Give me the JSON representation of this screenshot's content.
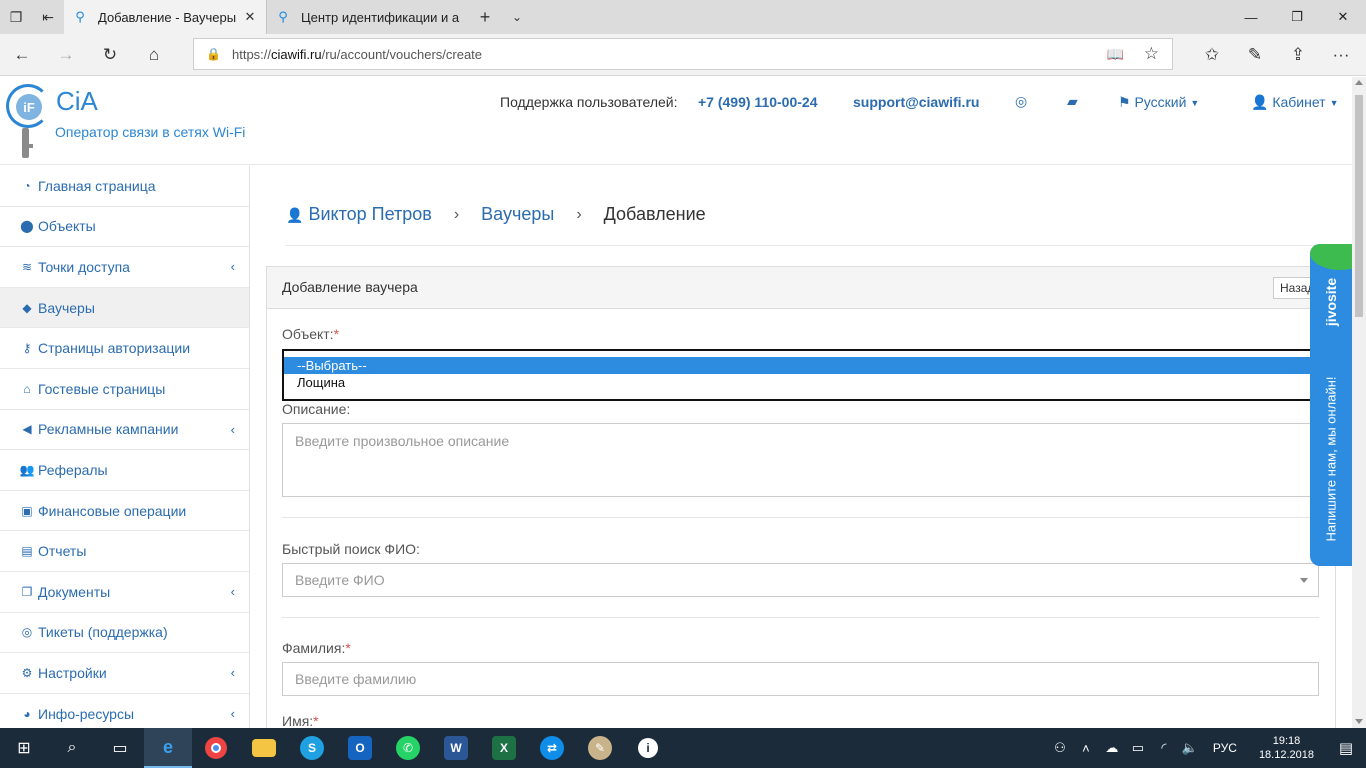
{
  "browser": {
    "tabs": [
      {
        "title": "Добавление - Ваучеры",
        "active": true
      },
      {
        "title": "Центр идентификации и а",
        "active": false
      }
    ],
    "url_prefix": "https://",
    "url_host": "ciawifi.ru",
    "url_path": "/ru/account/vouchers/create"
  },
  "header": {
    "brand": "CiA",
    "tagline": "Оператор связи в сетях Wi-Fi",
    "support_label": "Поддержка пользователей:",
    "phone": "+7 (499) 110-00-24",
    "email": "support@ciawifi.ru",
    "language": "Русский",
    "cabinet": "Кабинет"
  },
  "sidebar": {
    "items": [
      {
        "label": "Главная страница",
        "icon": "dashboard-icon",
        "glyph": "◔",
        "expandable": false,
        "active": false
      },
      {
        "label": "Объекты",
        "icon": "map-marker-icon",
        "glyph": "⬤",
        "expandable": false,
        "active": false
      },
      {
        "label": "Точки доступа",
        "icon": "wifi-icon",
        "glyph": "≋",
        "expandable": true,
        "active": false
      },
      {
        "label": "Ваучеры",
        "icon": "ticket-icon",
        "glyph": "◆",
        "expandable": false,
        "active": true
      },
      {
        "label": "Страницы авторизации",
        "icon": "key-icon",
        "glyph": "⚷",
        "expandable": false,
        "active": false
      },
      {
        "label": "Гостевые страницы",
        "icon": "home-icon",
        "glyph": "⌂",
        "expandable": false,
        "active": false
      },
      {
        "label": "Рекламные кампании",
        "icon": "bullhorn-icon",
        "glyph": "◀",
        "expandable": true,
        "active": false
      },
      {
        "label": "Рефералы",
        "icon": "users-icon",
        "glyph": "👥",
        "expandable": false,
        "active": false
      },
      {
        "label": "Финансовые операции",
        "icon": "money-icon",
        "glyph": "▣",
        "expandable": false,
        "active": false
      },
      {
        "label": "Отчеты",
        "icon": "file-icon",
        "glyph": "▤",
        "expandable": false,
        "active": false
      },
      {
        "label": "Документы",
        "icon": "files-icon",
        "glyph": "❐",
        "expandable": true,
        "active": false
      },
      {
        "label": "Тикеты (поддержка)",
        "icon": "lifebuoy-icon",
        "glyph": "◎",
        "expandable": false,
        "active": false
      },
      {
        "label": "Настройки",
        "icon": "cogs-icon",
        "glyph": "⚙",
        "expandable": true,
        "active": false
      },
      {
        "label": "Инфо-ресурсы",
        "icon": "globe-icon",
        "glyph": "◕",
        "expandable": true,
        "active": false
      }
    ]
  },
  "breadcrumb": {
    "user": "Виктор Петров",
    "section": "Ваучеры",
    "current": "Добавление"
  },
  "form": {
    "title": "Добавление ваучера",
    "back_button": "Назад",
    "object_label": "Объект:",
    "object_options": [
      "--Выбрать--",
      "Лощина"
    ],
    "object_selected": "--Выбрать--",
    "description_label": "Описание:",
    "description_placeholder": "Введите произвольное описание",
    "fio_search_label": "Быстрый поиск ФИО:",
    "fio_search_placeholder": "Введите ФИО",
    "surname_label": "Фамилия:",
    "surname_placeholder": "Введите фамилию",
    "name_label": "Имя:",
    "required_mark": "*"
  },
  "chat_widget": {
    "brand": "jivosite",
    "message": "Напишите нам, мы онлайн!"
  },
  "taskbar": {
    "language": "РУС",
    "time": "19:18",
    "date": "18.12.2018"
  },
  "colors": {
    "accent": "#2b6cb0",
    "brand_blue": "#2b87d3",
    "chat_blue": "#2d8ce0",
    "chat_green": "#3dbb4f",
    "required_red": "#d9534f",
    "taskbar": "#1c2b3a"
  }
}
